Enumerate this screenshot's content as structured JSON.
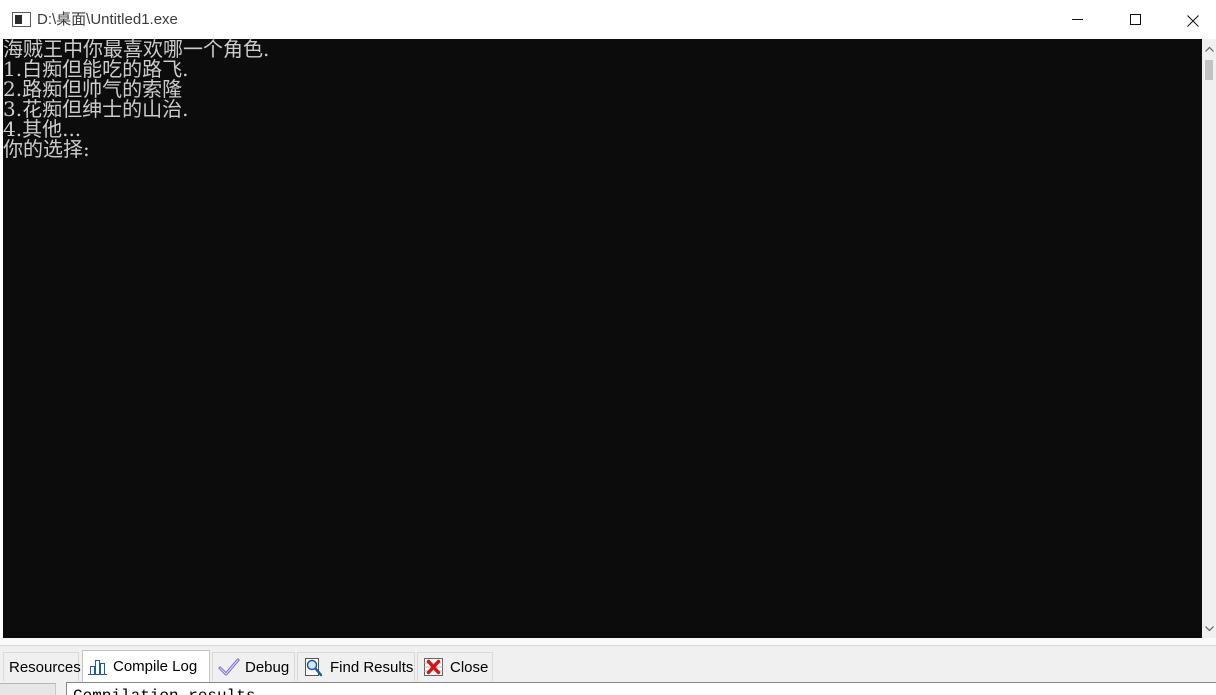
{
  "window": {
    "title": "D:\\桌面\\Untitled1.exe",
    "icon": "console-app-icon",
    "controls": [
      "minimize-icon",
      "maximize-icon",
      "close-icon"
    ]
  },
  "console": {
    "lines": [
      "海贼王中你最喜欢哪一个角色.",
      "1.白痴但能吃的路飞.",
      "2.路痴但帅气的索隆",
      "3.花痴但绅士的山治.",
      "4.其他...",
      "你的选择:"
    ],
    "scrollbar_icons": [
      "chevron-up-icon",
      "chevron-down-icon"
    ]
  },
  "ide": {
    "bottom_tabs": [
      {
        "label": "Resources",
        "selected": false
      },
      {
        "label": "Compile Log",
        "icon": "bar-chart-icon",
        "selected": true
      },
      {
        "label": "Debug",
        "icon": "checkmark-icon",
        "selected": false
      },
      {
        "label": "Find Results",
        "icon": "find-in-document-icon",
        "selected": false
      },
      {
        "label": "Close",
        "icon": "close-panel-icon",
        "selected": false
      }
    ],
    "compile_log_text": "Compilation results"
  },
  "colors": {
    "console_background": "#0c0c0c",
    "console_text": "#cccccc",
    "titlebar_background": "#ffffff",
    "ide_background": "#f0f0f0"
  }
}
